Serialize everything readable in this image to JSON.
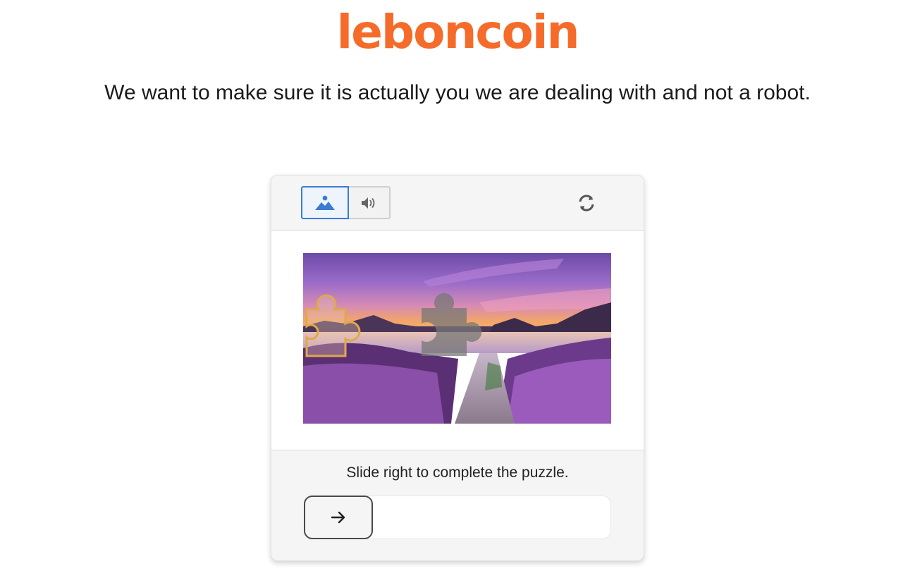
{
  "brand": {
    "logo_text": "leboncoin",
    "logo_color": "#f56b2a"
  },
  "tagline": "We want to make sure it is actually you we are dealing with and not a robot.",
  "captcha": {
    "modes": [
      {
        "name": "image",
        "icon": "image-icon",
        "active": true
      },
      {
        "name": "audio",
        "icon": "speaker-icon",
        "active": false
      }
    ],
    "refresh_icon": "refresh-icon",
    "accent_color": "#3a7bd5",
    "instruction": "Slide right to complete the puzzle.",
    "slider": {
      "icon": "arrow-right-icon",
      "progress": 0
    }
  }
}
